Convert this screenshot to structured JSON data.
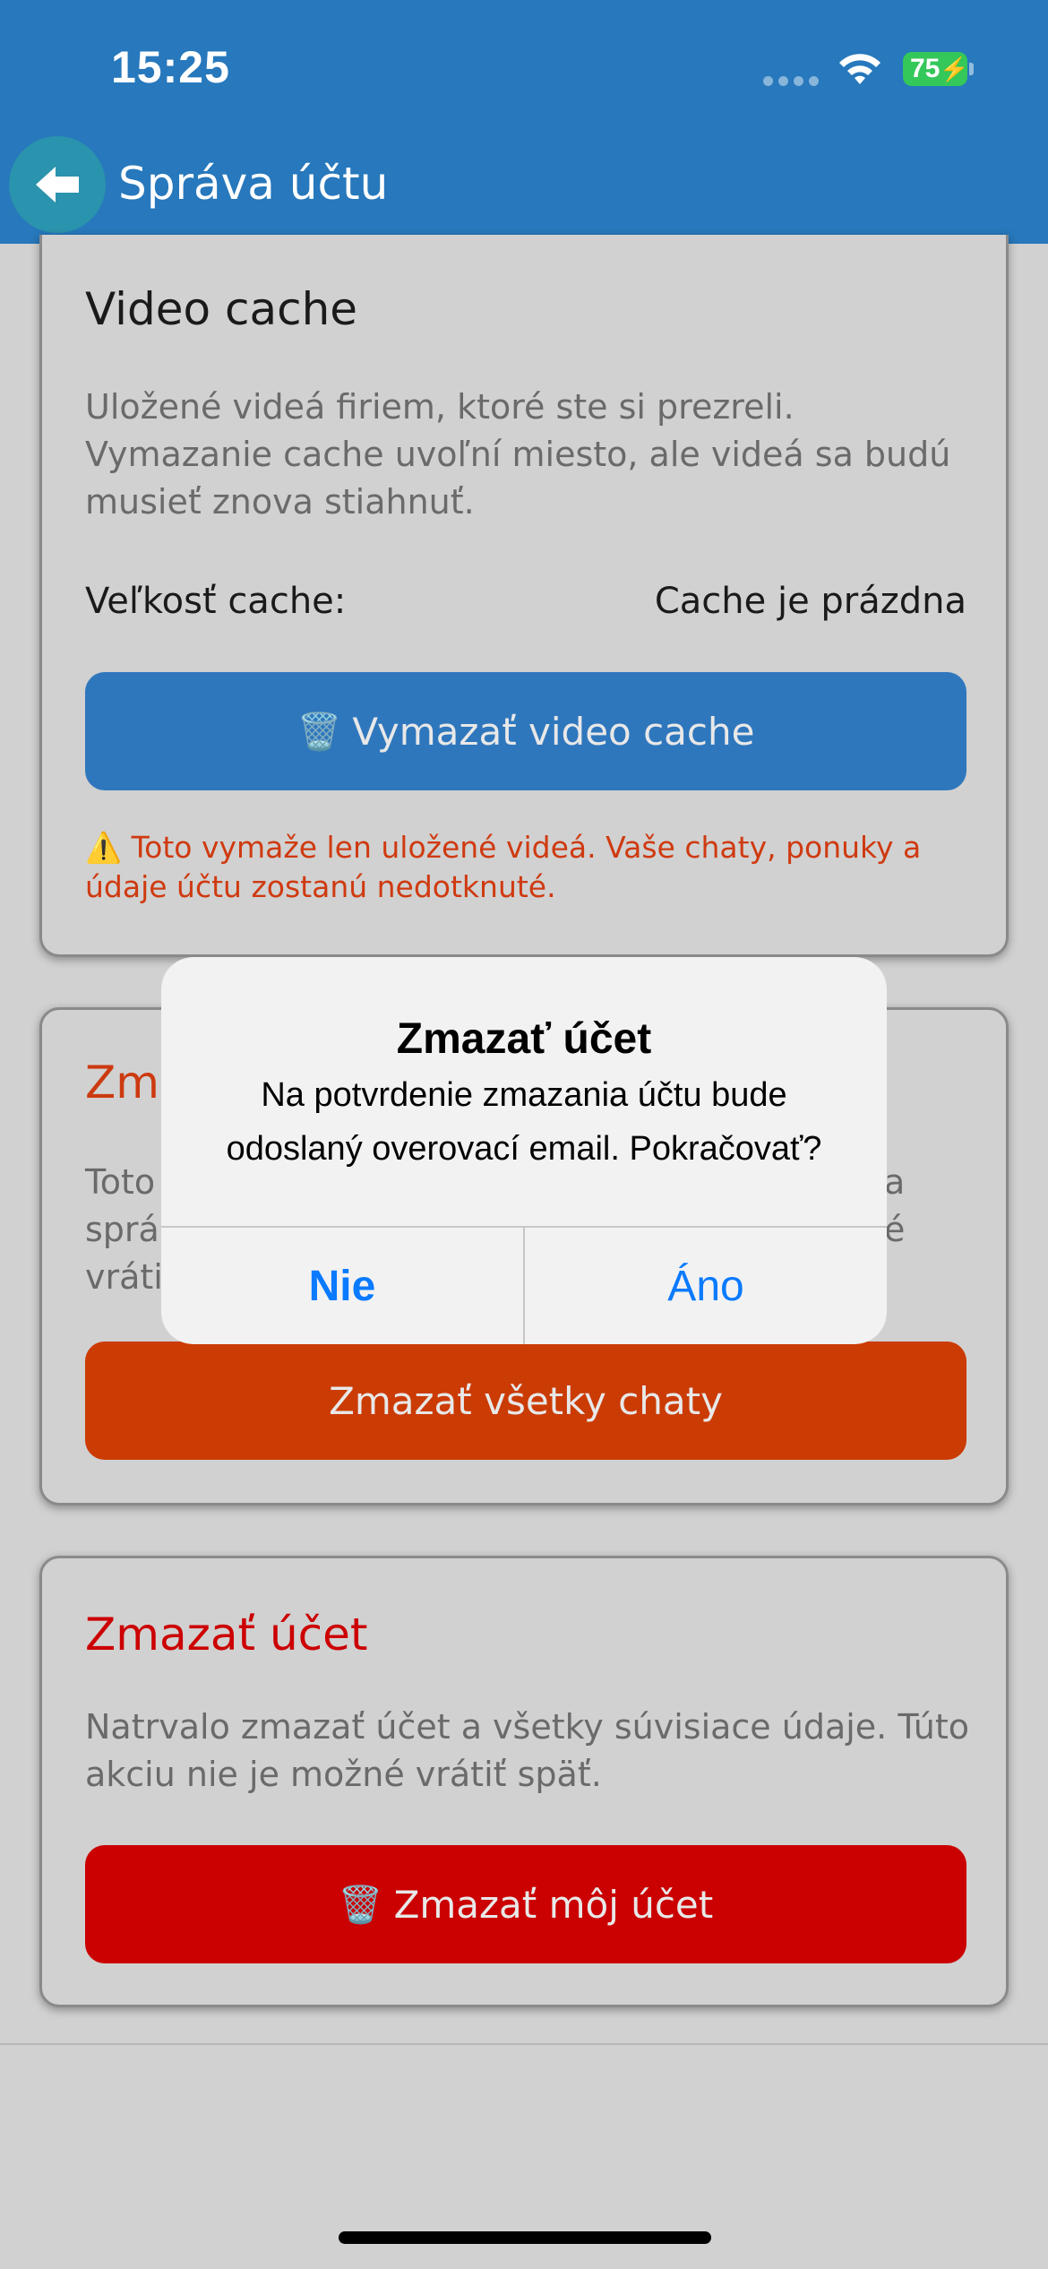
{
  "status_bar": {
    "time": "15:25",
    "battery": "75"
  },
  "header": {
    "title": "Správa účtu"
  },
  "video_cache": {
    "title": "Video cache",
    "description": "Uložené videá firiem, ktoré ste si prezreli. Vymazanie cache uvoľní miesto, ale videá sa budú musieť znova stiahnuť.",
    "size_label": "Veľkosť cache:",
    "size_value": "Cache je prázdna",
    "button_icon": "🗑️",
    "button_label": "Vymazať video cache",
    "warning_icon": "⚠️",
    "warning": "Toto vymaže len uložené videá. Vaše chaty, ponuky a údaje účtu zostanú nedotknuté."
  },
  "delete_chats": {
    "title": "Zma",
    "description": "Toto sprá vráti a é",
    "description_lines": [
      "Toto",
      "sprá",
      "vráti"
    ],
    "description_right": [
      "a",
      "é"
    ],
    "button_label": "Zmazať všetky chaty"
  },
  "delete_account": {
    "title": "Zmazať účet",
    "description": "Natrvalo zmazať účet a všetky súvisiace údaje. Túto akciu nie je možné vrátiť späť.",
    "button_icon": "🗑️",
    "button_label": "Zmazať môj účet"
  },
  "alert": {
    "title": "Zmazať účet",
    "message": "Na potvrdenie zmazania účtu bude odoslaný overovací email. Pokračovať?",
    "cancel_label": "Nie",
    "confirm_label": "Áno"
  },
  "colors": {
    "header": "#2778bc",
    "cache_button": "#2f77bd",
    "chats_button": "#cb3b04",
    "account_button": "#cb0000",
    "alert_action": "#0a7aff"
  },
  "icons": [
    "back-arrow-icon",
    "wifi-icon",
    "battery-icon",
    "trash-icon",
    "warning-icon"
  ]
}
